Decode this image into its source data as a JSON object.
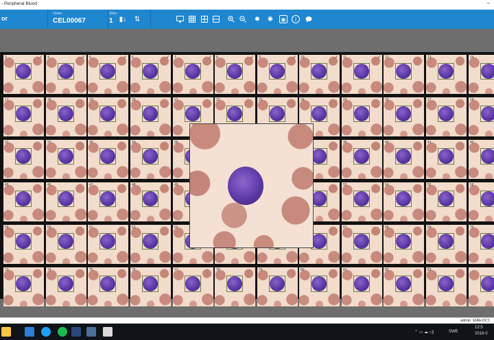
{
  "window": {
    "title": "- Peripheral Blood",
    "minimize_glyph": "–"
  },
  "toolbar": {
    "left_label": "or",
    "order_caption": "Order:",
    "order_value": "CEL00067",
    "slide_caption": "Slide:",
    "slide_value": "1",
    "icons": [
      "sort-icon",
      "filter-icon",
      "monitor-icon",
      "grid-small-icon",
      "grid-medium-icon",
      "grid-large-icon",
      "zoom-in-icon",
      "zoom-out-icon",
      "brightness-up-icon",
      "brightness-down-icon",
      "reference-icon",
      "info-icon",
      "comment-icon"
    ]
  },
  "cells": [
    {
      "num": "3",
      "checked": true
    },
    {
      "num": "4",
      "checked": true
    },
    {
      "num": "5",
      "checked": true
    },
    {
      "num": "6",
      "checked": true
    },
    {
      "num": "7",
      "checked": true
    },
    {
      "num": "8",
      "checked": true
    },
    {
      "num": "9",
      "checked": true
    },
    {
      "num": "10",
      "checked": true
    },
    {
      "num": "11",
      "checked": true
    },
    {
      "num": "12",
      "checked": false
    },
    {
      "num": "13",
      "checked": false
    },
    {
      "num": "14",
      "checked": false
    },
    {
      "num": "17",
      "checked": false
    },
    {
      "num": "18",
      "checked": false
    },
    {
      "num": "19",
      "checked": false
    },
    {
      "num": "20",
      "checked": false
    },
    {
      "num": "21",
      "checked": false
    },
    {
      "num": "22",
      "checked": false
    },
    {
      "num": "23",
      "checked": false
    },
    {
      "num": "24",
      "checked": false
    },
    {
      "num": "25",
      "checked": false
    },
    {
      "num": "26",
      "checked": false
    },
    {
      "num": "27",
      "checked": false
    },
    {
      "num": "28",
      "checked": false
    },
    {
      "num": "31",
      "checked": false
    },
    {
      "num": "32",
      "checked": false
    },
    {
      "num": "33",
      "checked": false
    },
    {
      "num": "34",
      "checked": false
    },
    {
      "num": "35",
      "checked": false
    },
    {
      "num": "",
      "checked": false
    },
    {
      "num": "",
      "checked": false
    },
    {
      "num": "",
      "checked": false
    },
    {
      "num": "39",
      "checked": false
    },
    {
      "num": "40",
      "checked": false
    },
    {
      "num": "41",
      "checked": false
    },
    {
      "num": "42",
      "checked": false
    },
    {
      "num": "45",
      "checked": false
    },
    {
      "num": "46",
      "checked": false
    },
    {
      "num": "47",
      "checked": false
    },
    {
      "num": "48",
      "checked": false
    },
    {
      "num": "49",
      "checked": false
    },
    {
      "num": "",
      "checked": false
    },
    {
      "num": "",
      "checked": false
    },
    {
      "num": "",
      "checked": false
    },
    {
      "num": "53",
      "checked": false
    },
    {
      "num": "54",
      "checked": false
    },
    {
      "num": "55",
      "checked": false
    },
    {
      "num": "56",
      "checked": false
    },
    {
      "num": "59",
      "checked": false
    },
    {
      "num": "60",
      "checked": false
    },
    {
      "num": "61",
      "checked": false
    },
    {
      "num": "62",
      "checked": false
    },
    {
      "num": "63",
      "checked": false
    },
    {
      "num": "",
      "checked": false
    },
    {
      "num": "",
      "checked": false
    },
    {
      "num": "",
      "checked": false
    },
    {
      "num": "67",
      "checked": false
    },
    {
      "num": "68",
      "checked": false
    },
    {
      "num": "69",
      "checked": false
    },
    {
      "num": "70",
      "checked": false
    },
    {
      "num": "73",
      "checked": false
    },
    {
      "num": "74",
      "checked": false
    },
    {
      "num": "75",
      "checked": false
    },
    {
      "num": "76",
      "checked": false
    },
    {
      "num": "77",
      "checked": false
    },
    {
      "num": "78",
      "checked": false
    },
    {
      "num": "79",
      "checked": false
    },
    {
      "num": "80",
      "checked": false
    },
    {
      "num": "81",
      "checked": false
    },
    {
      "num": "82",
      "checked": false
    },
    {
      "num": "83",
      "checked": false
    },
    {
      "num": "",
      "checked": false
    }
  ],
  "status": {
    "user": "admin",
    "station": "EIAb-DC1"
  },
  "taskbar": {
    "apps": [
      "start-icon",
      "explorer-icon",
      "edge-icon",
      "store-icon",
      "skype-icon",
      "spotify-icon",
      "app-icon",
      "browser-icon",
      "photos-icon"
    ],
    "tray": {
      "lang": "SWE",
      "time": "12:5",
      "date": "2018-0"
    }
  }
}
